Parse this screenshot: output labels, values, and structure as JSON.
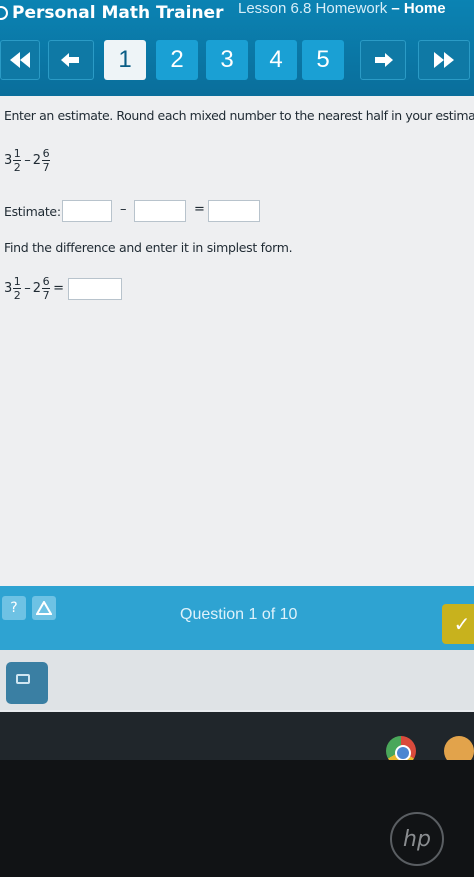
{
  "header": {
    "app_title": "Personal Math Trainer",
    "lesson_title": "Lesson 6.8 Homework",
    "lesson_suffix": " – Home"
  },
  "nav": {
    "numbers": [
      "1",
      "2",
      "3",
      "4",
      "5"
    ],
    "active": "1"
  },
  "question": {
    "instruction": "Enter an estimate. Round each mixed number to the nearest half in your estimate.",
    "expr1": {
      "whole1": "3",
      "num1": "1",
      "den1": "2",
      "minus": "–",
      "whole2": "2",
      "num2": "6",
      "den2": "7"
    },
    "estimate_label": "Estimate:",
    "estimate_minus": "–",
    "estimate_equals": "=",
    "difference_instruction": "Find the difference and enter it in simplest form.",
    "expr2": {
      "whole1": "3",
      "num1": "1",
      "den1": "2",
      "minus": "–",
      "whole2": "2",
      "num2": "6",
      "den2": "7",
      "equals": "="
    }
  },
  "footer": {
    "help_label": "?",
    "question_counter": "Question 1 of 10",
    "check_label": "✓"
  },
  "colors": {
    "header_blue": "#0b83b3",
    "tab_blue": "#1aa0d4",
    "footer_blue": "#2ea3d2",
    "check_gold": "#c8b21d"
  },
  "bezel": {
    "logo": "hp"
  }
}
